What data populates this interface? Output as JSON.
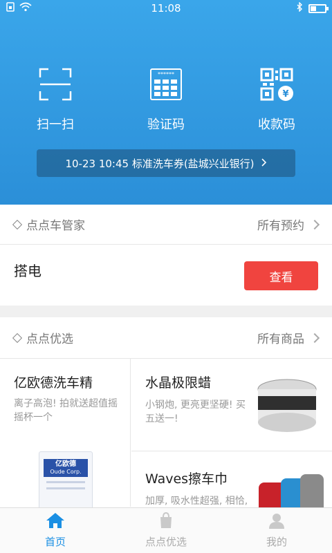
{
  "status_bar": {
    "time": "11:08"
  },
  "quick_actions": [
    {
      "label": "扫一扫",
      "icon": "scan-icon"
    },
    {
      "label": "验证码",
      "icon": "keypad-icon"
    },
    {
      "label": "收款码",
      "icon": "qr-payment-icon"
    }
  ],
  "coupon": {
    "text": "10-23 10:45 标准洗车券(盐城兴业银行)"
  },
  "butler": {
    "title": "点点车管家",
    "more_label": "所有预约",
    "service_name": "搭电",
    "view_button": "查看"
  },
  "picks": {
    "title": "点点优选",
    "more_label": "所有商品",
    "products": [
      {
        "name": "亿欧德洗车精",
        "desc": "离子高泡! 拍就送超值摇摇杯一个",
        "brand_text": "亿欧德",
        "brand_sub": "Oude Corp."
      },
      {
        "name": "水晶极限蜡",
        "desc": "小钢炮, 更亮更坚硬! 买五送一!"
      },
      {
        "name": "Waves擦车巾",
        "desc": "加厚, 吸水性超强, 相恰, 颜色丰富"
      }
    ]
  },
  "tabs": [
    {
      "label": "首页",
      "icon": "home-icon",
      "active": true
    },
    {
      "label": "点点优选",
      "icon": "shopping-bag-icon",
      "active": false
    },
    {
      "label": "我的",
      "icon": "profile-icon",
      "active": false
    }
  ],
  "colors": {
    "accent": "#1a8fe3",
    "danger": "#f0443f",
    "hero_blue": "#2b8fd8"
  }
}
